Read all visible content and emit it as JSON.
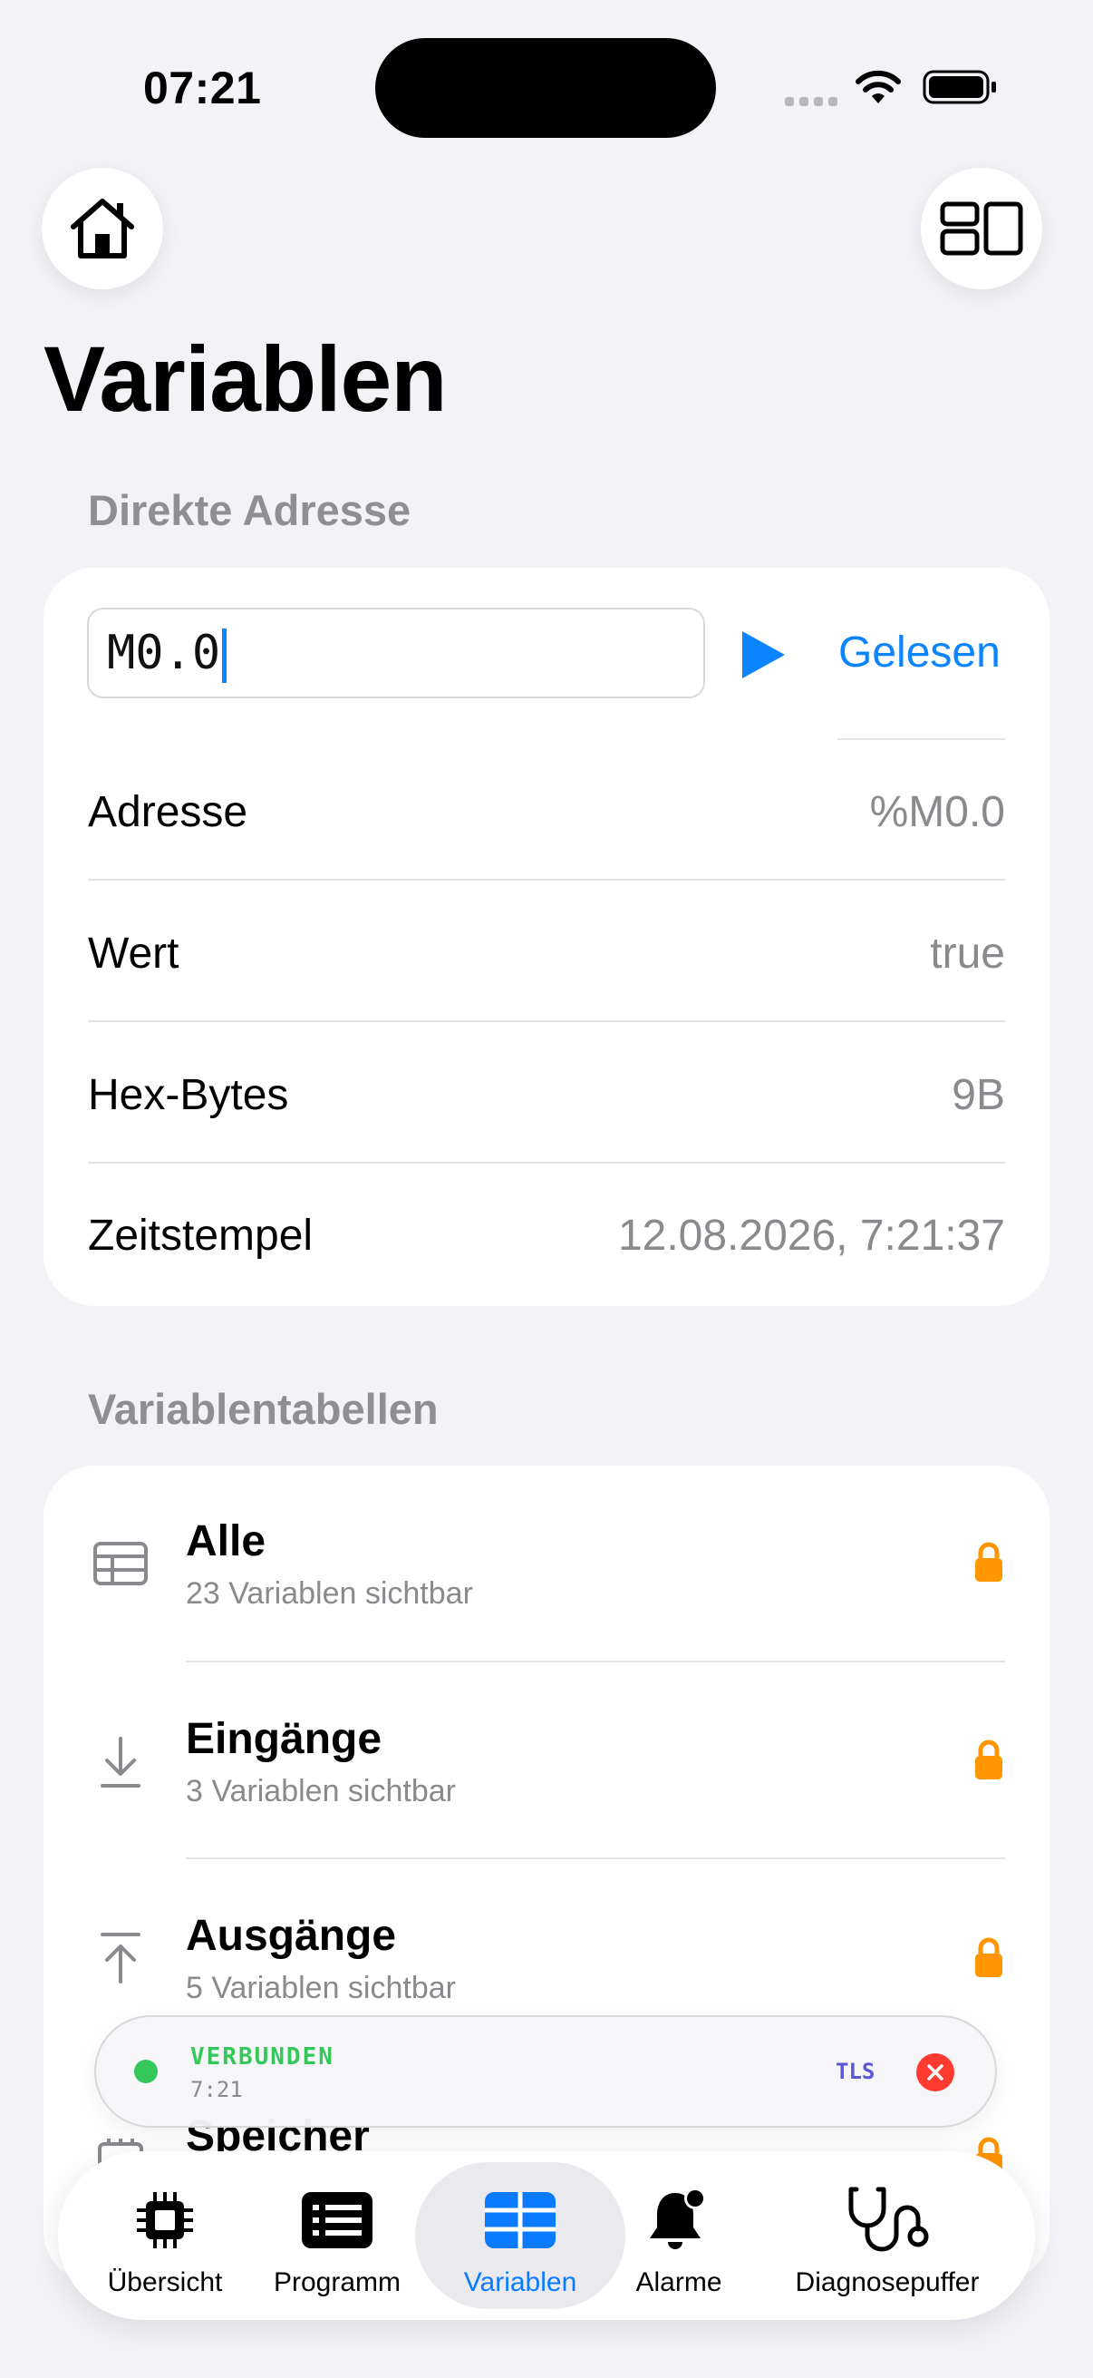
{
  "status_bar": {
    "time": "07:21"
  },
  "page": {
    "title": "Variablen"
  },
  "direct_address": {
    "section_title": "Direkte Adresse",
    "input_value": "M0.0",
    "read_label": "Gelesen",
    "rows": [
      {
        "label": "Adresse",
        "value": "%M0.0"
      },
      {
        "label": "Wert",
        "value": "true"
      },
      {
        "label": "Hex-Bytes",
        "value": "9B"
      },
      {
        "label": "Zeitstempel",
        "value": "12.08.2026, 7:21:37"
      }
    ]
  },
  "variable_tables": {
    "section_title": "Variablentabellen",
    "items": [
      {
        "title": "Alle",
        "subtitle": "23 Variablen sichtbar",
        "icon": "table-icon",
        "locked": true
      },
      {
        "title": "Eingänge",
        "subtitle": "3 Variablen sichtbar",
        "icon": "arrow-down-to-line-icon",
        "locked": true
      },
      {
        "title": "Ausgänge",
        "subtitle": "5 Variablen sichtbar",
        "icon": "arrow-up-from-line-icon",
        "locked": true
      },
      {
        "title": "Speicher",
        "subtitle": "",
        "icon": "memory-icon",
        "locked": true
      }
    ]
  },
  "connection": {
    "status": "VERBUNDEN",
    "time": "7:21",
    "badge": "TLS",
    "status_color": "#34C759"
  },
  "tab_bar": {
    "active": "Variablen",
    "items": [
      {
        "label": "Übersicht",
        "icon": "cpu-icon"
      },
      {
        "label": "Programm",
        "icon": "list-icon"
      },
      {
        "label": "Variablen",
        "icon": "grid-table-icon"
      },
      {
        "label": "Alarme",
        "icon": "bell-badge-icon"
      },
      {
        "label": "Diagnosepuffer",
        "icon": "stethoscope-icon"
      }
    ]
  },
  "colors": {
    "accent": "#0A84FF",
    "lock": "#FF9500",
    "close": "#FF3B30",
    "tls": "#5856D6"
  }
}
